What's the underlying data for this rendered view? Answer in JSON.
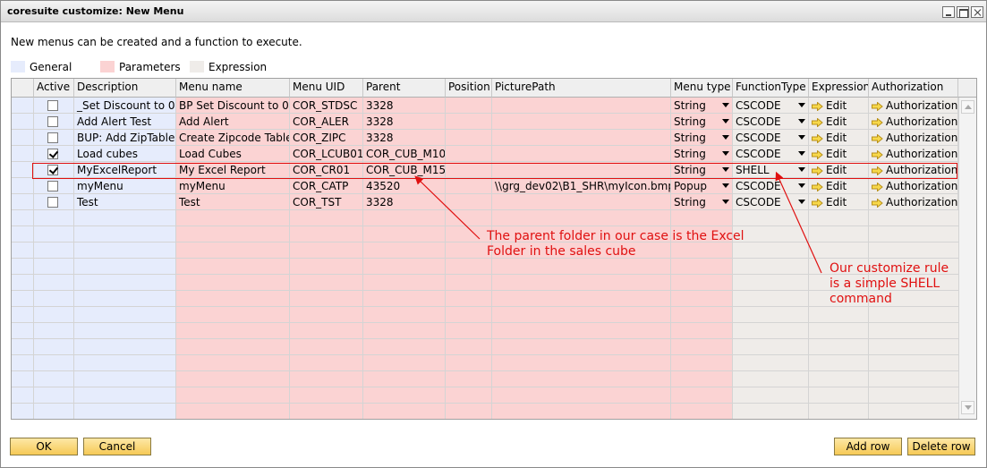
{
  "window": {
    "title": "coresuite customize: New Menu"
  },
  "intro_text": "New menus can be created and a function to execute.",
  "legend": [
    {
      "label": "General",
      "color": "#e6ecfc"
    },
    {
      "label": "Parameters",
      "color": "#fbd3d3"
    },
    {
      "label": "Expression",
      "color": "#efece9"
    }
  ],
  "columns": [
    {
      "label": ""
    },
    {
      "label": "Active"
    },
    {
      "label": "Description"
    },
    {
      "label": "Menu name"
    },
    {
      "label": "Menu UID"
    },
    {
      "label": "Parent"
    },
    {
      "label": "Position"
    },
    {
      "label": "PicturePath"
    },
    {
      "label": "Menu type"
    },
    {
      "label": "FunctionType"
    },
    {
      "label": "Expression"
    },
    {
      "label": "Authorization"
    }
  ],
  "rows": [
    {
      "active": false,
      "description": "_Set Discount to 0",
      "menu_name": "BP Set Discount to 0",
      "menu_uid": "COR_STDSC",
      "parent": "3328",
      "position": "",
      "picture_path": "",
      "menu_type": "String",
      "function_type": "CSCODE",
      "expression": "Edit",
      "authorization": "Authorization"
    },
    {
      "active": false,
      "description": "Add Alert Test",
      "menu_name": "Add Alert",
      "menu_uid": "COR_ALER",
      "parent": "3328",
      "position": "",
      "picture_path": "",
      "menu_type": "String",
      "function_type": "CSCODE",
      "expression": "Edit",
      "authorization": "Authorization"
    },
    {
      "active": false,
      "description": "BUP: Add ZipTable",
      "menu_name": "Create Zipcode Table",
      "menu_uid": "COR_ZIPC",
      "parent": "3328",
      "position": "",
      "picture_path": "",
      "menu_type": "String",
      "function_type": "CSCODE",
      "expression": "Edit",
      "authorization": "Authorization"
    },
    {
      "active": true,
      "description": "Load cubes",
      "menu_name": "Load Cubes",
      "menu_uid": "COR_LCUB01",
      "parent": "COR_CUB_M10",
      "position": "",
      "picture_path": "",
      "menu_type": "String",
      "function_type": "CSCODE",
      "expression": "Edit",
      "authorization": "Authorization"
    },
    {
      "active": true,
      "description": "MyExcelReport",
      "menu_name": "My Excel Report",
      "menu_uid": "COR_CR01",
      "parent": "COR_CUB_M15",
      "position": "",
      "picture_path": "",
      "menu_type": "String",
      "function_type": "SHELL",
      "expression": "Edit",
      "authorization": "Authorization"
    },
    {
      "active": false,
      "description": "myMenu",
      "menu_name": "myMenu",
      "menu_uid": "COR_CATP",
      "parent": "43520",
      "position": "",
      "picture_path": "\\\\grg_dev02\\B1_SHR\\myIcon.bmp",
      "menu_type": "Popup",
      "function_type": "CSCODE",
      "expression": "Edit",
      "authorization": "Authorization"
    },
    {
      "active": false,
      "description": "Test",
      "menu_name": "Test",
      "menu_uid": "COR_TST",
      "parent": "3328",
      "position": "",
      "picture_path": "",
      "menu_type": "String",
      "function_type": "CSCODE",
      "expression": "Edit",
      "authorization": "Authorization"
    }
  ],
  "annotations": {
    "parent_note": [
      "The parent folder in our case is the Excel",
      "Folder in the sales cube"
    ],
    "rule_note": [
      "Our customize rule",
      "is a simple SHELL",
      "command"
    ],
    "color": "#e01010"
  },
  "buttons": {
    "ok": "OK",
    "cancel": "Cancel",
    "add_row": "Add row",
    "delete_row": "Delete row"
  },
  "icons": {
    "link_arrow": "arrow-right-icon",
    "dropdown": "dropdown-arrow-icon"
  }
}
